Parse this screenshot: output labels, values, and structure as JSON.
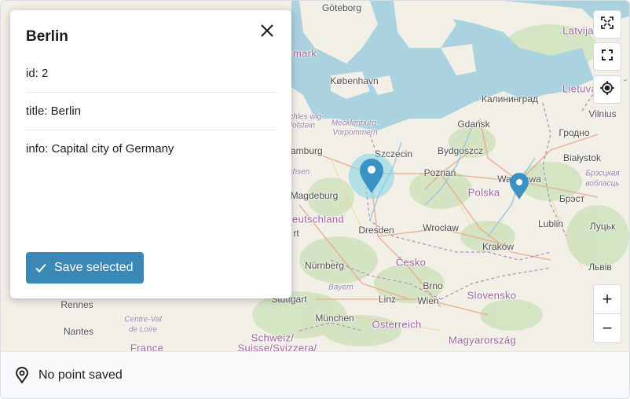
{
  "map": {
    "labels": {
      "goteborg": "Göteborg",
      "latvija": "Latvija",
      "denmark": "mark",
      "kobenhavn": "København",
      "kaliningrad": "Калининград",
      "lietuva": "Lietuva",
      "vilnius": "Vilnius",
      "schleswig": "Schles wig-",
      "holstein": "Holstein",
      "mecklenburg": "Mecklenburg-",
      "vorpommern": "Vorpommern",
      "gdansk": "Gdańsk",
      "grodno": "Гродно",
      "hamburg": "Hamburg",
      "szczecin": "Szczecin",
      "bydgoszcz": "Bydgoszcz",
      "bialystok": "Białystok",
      "sachsen": "chsen",
      "poznan": "Poznań",
      "warszawa": "Warszawa",
      "brestskaya": "Брэсцкая",
      "voblasts": "вобласць",
      "magdeburg": "Magdeburg",
      "polska": "Polska",
      "brest": "Брэст",
      "deutschland": "eutschland",
      "dresden": "Dresden",
      "wroclaw": "Wrocław",
      "lublin": "Lublin",
      "lutsk": "Луцьк",
      "frankfurt": "rt",
      "krakow": "Kraków",
      "cesko": "Česko",
      "nurnberg": "Nürnberg",
      "lviv": "Львів",
      "brno": "Brno",
      "rennes": "Rennes",
      "stuttgart": "Stuttgart",
      "bayern": "Bayern",
      "linz": "Linz",
      "wien": "Wien",
      "slovensko": "Slovensko",
      "centre": "Centre-Val",
      "loire": "de Loire",
      "munchen": "München",
      "nantes": "Nantes",
      "osterreich": "Österreich",
      "schweiz": "Schweiz/",
      "suisse": "Suisse/Svizzera/",
      "magyarorszag": "Magyarország",
      "france": "France"
    }
  },
  "controls": {
    "fit_icon": "fit-bounds-icon",
    "fullscreen_icon": "fullscreen-icon",
    "locate_icon": "locate-icon",
    "zoom_in": "+",
    "zoom_out": "−"
  },
  "popup": {
    "title": "Berlin",
    "rows": [
      "id: 2",
      "title: Berlin",
      "info: Capital city of Germany"
    ],
    "save_label": "Save selected"
  },
  "footer": {
    "status": "No point saved"
  },
  "colors": {
    "marker": "#3b93c4",
    "marker_halo": "#7fd3e6",
    "button": "#3b87b5",
    "water": "#aad3df",
    "land": "#f1efe6",
    "forest": "#c8e0b4"
  }
}
